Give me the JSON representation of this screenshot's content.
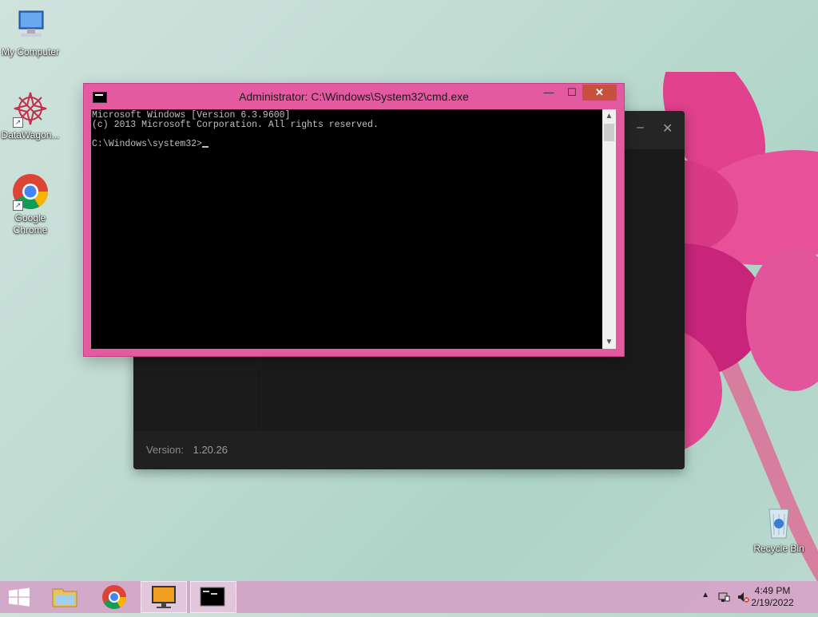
{
  "desktop": {
    "icons": [
      {
        "label": "My Computer",
        "icon": "computer-icon"
      },
      {
        "label": "DataWagon...",
        "icon": "datawagon-icon"
      },
      {
        "label": "Google Chrome",
        "icon": "chrome-icon"
      },
      {
        "label": "Recycle Bin",
        "icon": "recycle-bin-icon"
      }
    ]
  },
  "background_app": {
    "version_label": "Version:",
    "version_value": "1.20.26",
    "minimize_glyph": "–",
    "close_glyph": "✕"
  },
  "cmd_window": {
    "title": "Administrator: C:\\Windows\\System32\\cmd.exe",
    "minimize_glyph": "—",
    "maximize_glyph": "☐",
    "close_glyph": "✕",
    "lines": [
      "Microsoft Windows [Version 6.3.9600]",
      "(c) 2013 Microsoft Corporation. All rights reserved.",
      "",
      "C:\\Windows\\system32>"
    ]
  },
  "taskbar": {
    "items": [
      {
        "name": "start",
        "icon": "windows-logo-icon"
      },
      {
        "name": "file-explorer",
        "icon": "folder-icon"
      },
      {
        "name": "chrome",
        "icon": "chrome-icon"
      },
      {
        "name": "monitor-app",
        "icon": "monitor-icon"
      },
      {
        "name": "cmd",
        "icon": "cmd-icon",
        "active": true
      }
    ],
    "clock": {
      "time": "4:49 PM",
      "date": "2/19/2022"
    }
  },
  "colors": {
    "cmd_frame": "#e45aa0",
    "close_button": "#c7503f",
    "taskbar": "#d7a0c8"
  }
}
